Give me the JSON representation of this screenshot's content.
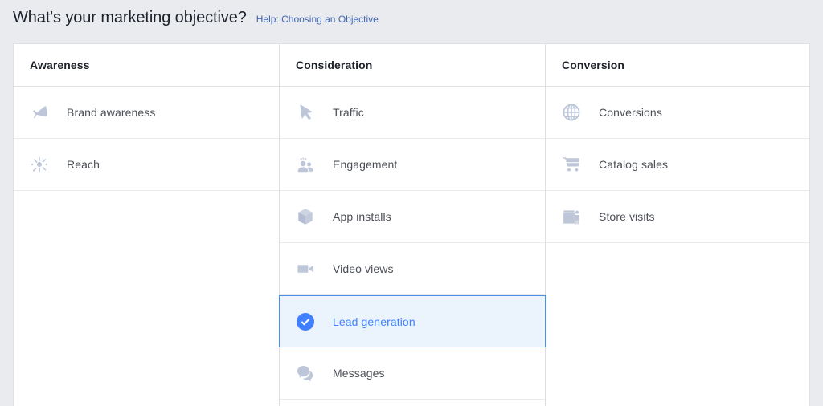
{
  "page": {
    "title": "What's your marketing objective?",
    "help_link": "Help: Choosing an Objective",
    "background_color": "#e9ebee",
    "accent_color": "#4080ff",
    "link_color": "#4267b2"
  },
  "columns": [
    {
      "id": "awareness",
      "header": "Awareness",
      "items": [
        {
          "label": "Brand awareness",
          "icon": "megaphone-icon",
          "selected": false
        },
        {
          "label": "Reach",
          "icon": "reach-burst-icon",
          "selected": false
        }
      ]
    },
    {
      "id": "consideration",
      "header": "Consideration",
      "items": [
        {
          "label": "Traffic",
          "icon": "cursor-arrow-icon",
          "selected": false
        },
        {
          "label": "Engagement",
          "icon": "people-group-icon",
          "selected": false
        },
        {
          "label": "App installs",
          "icon": "cube-box-icon",
          "selected": false
        },
        {
          "label": "Video views",
          "icon": "video-camera-icon",
          "selected": false
        },
        {
          "label": "Lead generation",
          "icon": "check-circle-icon",
          "selected": true
        },
        {
          "label": "Messages",
          "icon": "chat-bubbles-icon",
          "selected": false
        }
      ]
    },
    {
      "id": "conversion",
      "header": "Conversion",
      "items": [
        {
          "label": "Conversions",
          "icon": "globe-icon",
          "selected": false
        },
        {
          "label": "Catalog sales",
          "icon": "shopping-cart-icon",
          "selected": false
        },
        {
          "label": "Store visits",
          "icon": "storefront-icon",
          "selected": false
        }
      ]
    }
  ]
}
